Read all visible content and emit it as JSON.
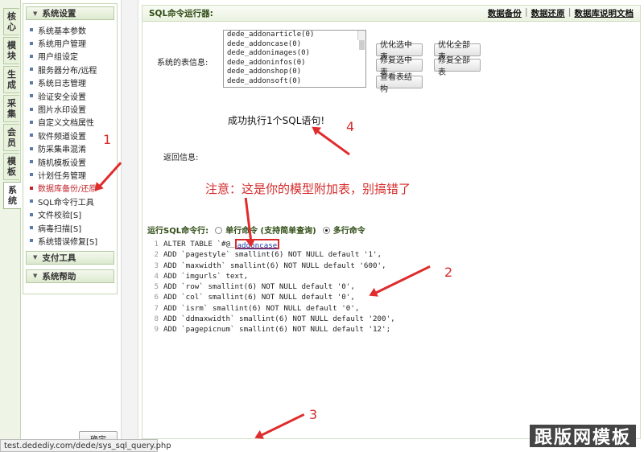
{
  "vertical_tabs": [
    "核心",
    "模块",
    "生成",
    "采集",
    "会员",
    "模板",
    "系统"
  ],
  "sidebar": {
    "header": "系统设置",
    "items": [
      {
        "label": "系统基本参数"
      },
      {
        "label": "系统用户管理"
      },
      {
        "label": "用户组设定"
      },
      {
        "label": "服务器分布/远程"
      },
      {
        "label": "系统日志管理"
      },
      {
        "label": "验证安全设置"
      },
      {
        "label": "图片水印设置"
      },
      {
        "label": "自定义文档属性"
      },
      {
        "label": "软件频道设置"
      },
      {
        "label": "防采集串混淆"
      },
      {
        "label": "随机模板设置"
      },
      {
        "label": "计划任务管理"
      },
      {
        "label": "数据库备份/还原"
      },
      {
        "label": "SQL命令行工具"
      },
      {
        "label": "文件校验[S]"
      },
      {
        "label": "病毒扫描[S]"
      },
      {
        "label": "系统错误修复[S]"
      }
    ],
    "footer_sections": [
      "支付工具",
      "系统帮助"
    ]
  },
  "main": {
    "title": "SQL命令运行器:",
    "links": [
      "数据备份",
      "数据还原",
      "数据库说明文档"
    ],
    "table_info_label": "系统的表信息:",
    "tables": [
      "dede_addonarticle(0)",
      "dede_addoncase(0)",
      "dede_addonimages(0)",
      "dede_addoninfos(0)",
      "dede_addonshop(0)",
      "dede_addonsoft(0)"
    ],
    "buttons": {
      "optimize_selected": "优化选中表",
      "optimize_all": "优化全部表",
      "repair_selected": "修复选中表",
      "repair_all": "修复全部表",
      "view_structure": "查看表结构"
    },
    "result_message": "成功执行1个SQL语句!",
    "return_info_label": "返回信息:",
    "run_label": "运行SQL命令行:",
    "mode_single": "单行命令 (支持简单查询)",
    "mode_multi": "多行命令",
    "code_lines": [
      {
        "n": "1",
        "pre": "ALTER TABLE `#@_",
        "hl": "addoncase",
        "post": ""
      },
      {
        "n": "2",
        "pre": "ADD `pagestyle` smallint(6) NOT NULL default '1',",
        "hl": "",
        "post": ""
      },
      {
        "n": "3",
        "pre": "ADD `maxwidth` smallint(6) NOT NULL default '600',",
        "hl": "",
        "post": ""
      },
      {
        "n": "4",
        "pre": "ADD `imgurls` text,",
        "hl": "",
        "post": ""
      },
      {
        "n": "5",
        "pre": "ADD `row` smallint(6) NOT NULL default '0',",
        "hl": "",
        "post": ""
      },
      {
        "n": "6",
        "pre": "ADD `col` smallint(6) NOT NULL default '0',",
        "hl": "",
        "post": ""
      },
      {
        "n": "7",
        "pre": "ADD `isrm` smallint(6) NOT NULL default '0',",
        "hl": "",
        "post": ""
      },
      {
        "n": "8",
        "pre": "ADD `ddmaxwidth` smallint(6) NOT NULL default '200',",
        "hl": "",
        "post": ""
      },
      {
        "n": "9",
        "pre": "ADD `pagepicnum` smallint(6) NOT NULL default '12';",
        "hl": "",
        "post": ""
      }
    ],
    "ok_button": "确定"
  },
  "annotations": {
    "note": "注意：这是你的模型附加表，别搞错了",
    "numbers": [
      "1",
      "2",
      "3",
      "4"
    ],
    "color": "#d62a2a"
  },
  "status_bar": "test.dedediy.com/dede/sys_sql_query.php",
  "watermark": "跟版网模板"
}
